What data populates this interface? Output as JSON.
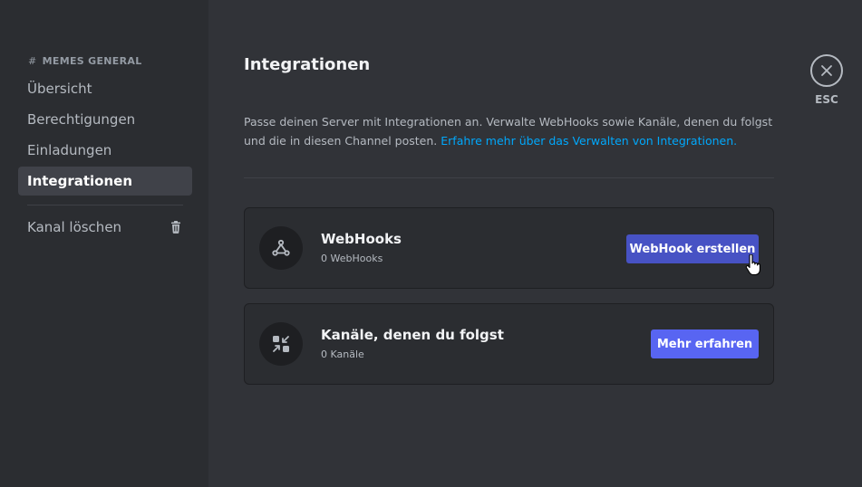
{
  "sidebar": {
    "header_hash": "#",
    "header": "MEMES GENERAL",
    "items": [
      {
        "label": "Übersicht"
      },
      {
        "label": "Berechtigungen"
      },
      {
        "label": "Einladungen"
      },
      {
        "label": "Integrationen",
        "active": true
      }
    ],
    "delete_label": "Kanal löschen",
    "delete_icon": "trash-icon"
  },
  "main": {
    "title": "Integrationen",
    "description": "Passe deinen Server mit Integrationen an. Verwalte WebHooks sowie Kanäle, denen du folgst und die in diesen Channel posten.",
    "link": "Erfahre mehr über das Verwalten von Integrationen."
  },
  "cards": [
    {
      "title": "WebHooks",
      "subtitle": "0 WebHooks",
      "button": "WebHook erstellen",
      "icon": "webhook-icon"
    },
    {
      "title": "Kanäle, denen du folgst",
      "subtitle": "0 Kanäle",
      "button": "Mehr erfahren",
      "icon": "followed-channels-icon"
    }
  ],
  "close": {
    "label": "ESC",
    "icon": "close-icon"
  },
  "colors": {
    "accent": "#5865f2",
    "accent_hover": "#4752c4",
    "link": "#00a8fc"
  }
}
